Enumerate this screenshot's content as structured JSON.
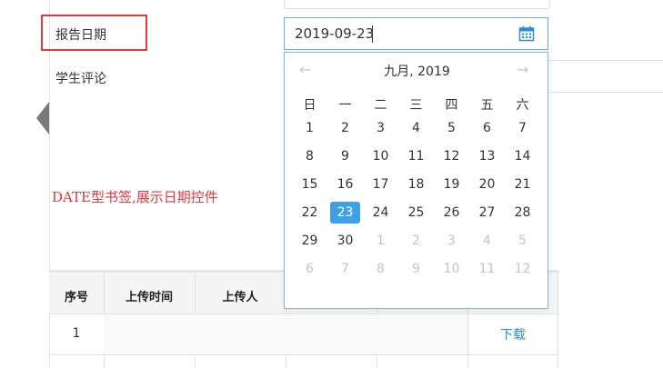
{
  "form": {
    "report_date_label": "报告日期",
    "student_comment_label": "学生评论",
    "date_value": "2019-09-23"
  },
  "annotation": "DATE型书签,展示日期控件",
  "datepicker": {
    "month_title": "九月, 2019",
    "prev_arrow": "←",
    "next_arrow": "→",
    "weekdays": [
      "日",
      "一",
      "二",
      "三",
      "四",
      "五",
      "六"
    ],
    "weeks": [
      [
        "1",
        "2",
        "3",
        "4",
        "5",
        "6",
        "7"
      ],
      [
        "8",
        "9",
        "10",
        "11",
        "12",
        "13",
        "14"
      ],
      [
        "15",
        "16",
        "17",
        "18",
        "19",
        "20",
        "21"
      ],
      [
        "22",
        "23",
        "24",
        "25",
        "26",
        "27",
        "28"
      ],
      [
        "29",
        "30",
        "1",
        "2",
        "3",
        "4",
        "5"
      ],
      [
        "6",
        "7",
        "8",
        "9",
        "10",
        "11",
        "12"
      ]
    ],
    "selected_day": "23",
    "accent_color": "#3fa0e6"
  },
  "table": {
    "headers": [
      "序号",
      "上传时间",
      "上传人"
    ],
    "rows": [
      {
        "index": "1",
        "action": "下载"
      }
    ]
  },
  "colors": {
    "highlight": "#e0393e",
    "link": "#2d8ccd"
  },
  "icons": {
    "calendar": "calendar-icon",
    "collapse": "left-triangle-icon"
  }
}
